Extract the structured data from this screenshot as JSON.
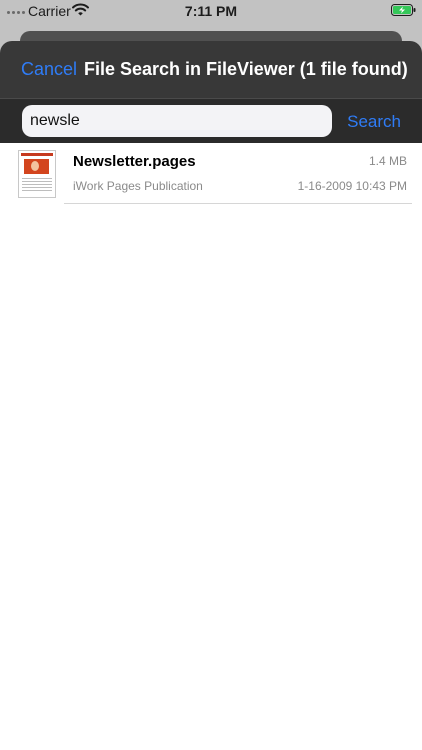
{
  "status_bar": {
    "carrier": "Carrier",
    "time": "7:11 PM",
    "icons": [
      "signal-dots-icon",
      "wifi-icon",
      "battery-charging-icon"
    ]
  },
  "header": {
    "cancel_label": "Cancel",
    "title": "File Search in FileViewer (1 file found)"
  },
  "search": {
    "value": "newsle",
    "button_label": "Search"
  },
  "results": [
    {
      "name": "Newsletter.pages",
      "size": "1.4 MB",
      "type": "iWork Pages Publication",
      "date": "1-16-2009 10:43 PM",
      "thumbnail_icon": "pages-document-thumbnail"
    }
  ],
  "colors": {
    "accent": "#2f7cf6",
    "header_bg": "#383838",
    "battery": "#34c759"
  }
}
